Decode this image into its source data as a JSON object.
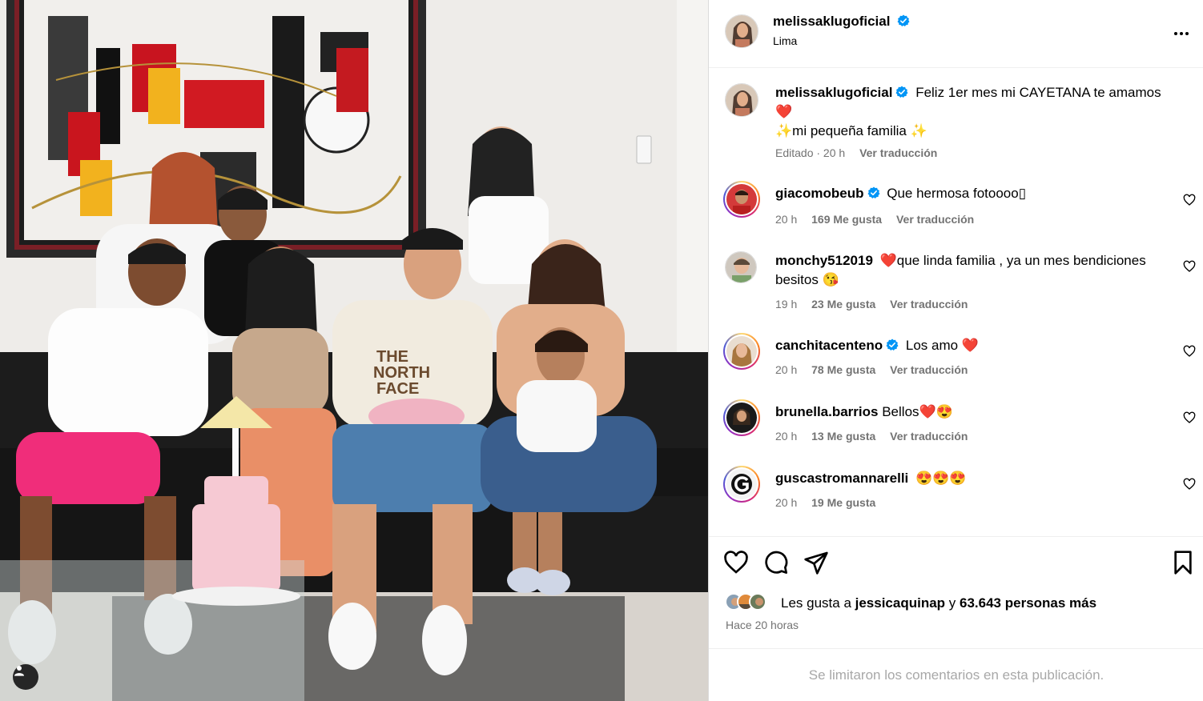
{
  "post": {
    "author": "melissaklugoficial",
    "location": "Lima",
    "caption_line1": "Feliz 1er mes mi CAYETANA te amamos",
    "caption_emoji1": "❤️",
    "caption_line2": "✨mi pequeña familia ✨",
    "caption_meta_edited": "Editado · 20 h",
    "caption_meta_translate": "Ver traducción"
  },
  "comments": [
    {
      "user": "giacomobeub",
      "verified": true,
      "text": "Que hermosa fotoooo▯",
      "time": "20 h",
      "likes": "169 Me gusta",
      "translate": "Ver traducción"
    },
    {
      "user": "monchy512019",
      "verified": false,
      "text": "❤️que linda familia , ya un mes bendiciones besitos 😘",
      "time": "19 h",
      "likes": "23 Me gusta",
      "translate": "Ver traducción"
    },
    {
      "user": "canchitacenteno",
      "verified": true,
      "text": "Los amo ❤️",
      "time": "20 h",
      "likes": "78 Me gusta",
      "translate": "Ver traducción"
    },
    {
      "user": "brunella.barrios",
      "verified": false,
      "text": "Bellos❤️😍",
      "time": "20 h",
      "likes": "13 Me gusta",
      "translate": "Ver traducción"
    },
    {
      "user": "guscastromannarelli",
      "verified": false,
      "text": "😍😍😍",
      "time": "20 h",
      "likes": "19 Me gusta",
      "translate": ""
    }
  ],
  "likes": {
    "prefix": "Les gusta a ",
    "user": "jessicaquinap",
    "middle": " y ",
    "count": "63.643 personas más"
  },
  "timestamp": "Hace 20 horas",
  "footer": "Se limitaron los comentarios en esta publicación.",
  "colors": {
    "verified": "#0095f6",
    "muted": "#737373"
  },
  "icons": [
    "user-tag-icon",
    "more-options-icon",
    "verified-badge-icon",
    "heart-icon",
    "comment-icon",
    "share-icon",
    "save-icon"
  ]
}
